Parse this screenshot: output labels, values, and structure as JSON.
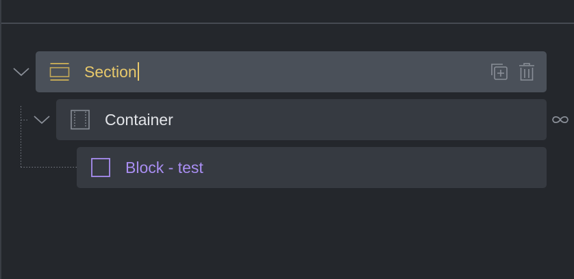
{
  "tree": {
    "section": {
      "label": "Section",
      "icon": "section-icon",
      "color": "#e8c96b",
      "expanded": true,
      "actions": [
        {
          "name": "duplicate-icon"
        },
        {
          "name": "trash-icon"
        }
      ]
    },
    "container": {
      "label": "Container",
      "icon": "container-icon",
      "color": "#e2e4e8",
      "expanded": true,
      "link_icon": "infinity-icon"
    },
    "block": {
      "label": "Block - test",
      "icon": "block-icon",
      "color": "#a98ef2"
    }
  },
  "colors": {
    "background": "#24272c",
    "row_active": "#4a5059",
    "row": "#363a41",
    "icon_muted": "#8a8f98"
  }
}
